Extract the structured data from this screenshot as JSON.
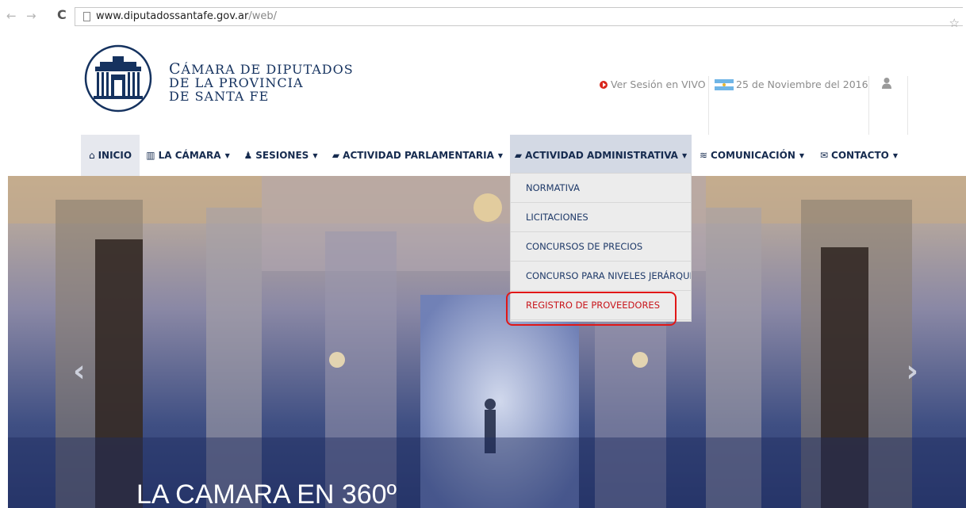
{
  "browser": {
    "back": "←",
    "forward": "→",
    "reload": "C",
    "url_domain": "www.diputadossantafe.gov.ar",
    "url_path": "/web/",
    "star": "☆"
  },
  "header": {
    "brand_line1_cap": "C",
    "brand_line1": "ÁMARA DE DIPUTADOS",
    "brand_line2": "DE LA PROVINCIA",
    "brand_line3": "DE SANTA FE",
    "live_label": "Ver Sesión en VIVO",
    "date": "25 de Noviembre del 2016"
  },
  "nav": {
    "items": [
      {
        "icon": "⌂",
        "label": "INICIO",
        "caret": ""
      },
      {
        "icon": "▥",
        "label": "LA CÁMARA",
        "caret": "▼"
      },
      {
        "icon": "♟",
        "label": "SESIONES",
        "caret": "▼"
      },
      {
        "icon": "▰",
        "label": "ACTIVIDAD PARLAMENTARIA",
        "caret": "▼"
      },
      {
        "icon": "▰",
        "label": "ACTIVIDAD ADMINISTRATIVA",
        "caret": "▼"
      },
      {
        "icon": "≋",
        "label": "COMUNICACIÓN",
        "caret": "▼"
      },
      {
        "icon": "✉",
        "label": "CONTACTO",
        "caret": "▼"
      }
    ]
  },
  "dropdown": {
    "options": [
      "NORMATIVA",
      "LICITACIONES",
      "CONCURSOS DE PRECIOS",
      "CONCURSO PARA NIVELES JERÁRQUI",
      "REGISTRO DE PROVEEDORES"
    ]
  },
  "hero": {
    "title": "LA CAMARA EN 360º",
    "prev": "‹",
    "next": "›"
  },
  "colors": {
    "brand": "#15325f",
    "nav_text": "#162b4f",
    "live_dot": "#d9261c",
    "highlight": "#e11717"
  }
}
